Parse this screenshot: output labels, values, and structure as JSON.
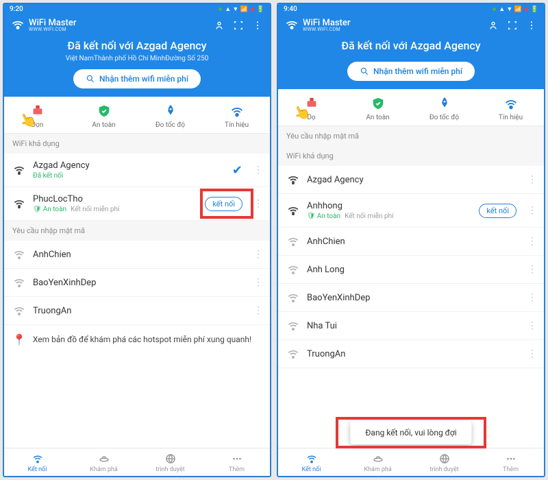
{
  "left": {
    "status": {
      "time": "9:20",
      "icons": [
        "📶",
        "🔋"
      ]
    },
    "brand": {
      "title": "WiFi Master",
      "sub": "WWW.WIFI.COM"
    },
    "header": {
      "conn_title": "Đã kết nối với Azgad Agency",
      "conn_sub": "Việt NamThành phố Hồ Chí MinhĐường Số 250",
      "free_btn": "Nhận thêm wifi miễn phí"
    },
    "features": {
      "clean": "Dọn",
      "safe": "An toàn",
      "speed": "Đo tốc độ",
      "signal": "Tín hiệu"
    },
    "sections": {
      "available": "WiFi khả dụng",
      "pwreq": "Yêu cầu nhập mật mã"
    },
    "networks_available": [
      {
        "name": "Azgad Agency",
        "sub_connected": "Đã kết nối",
        "connected": true
      },
      {
        "name": "PhucLocTho",
        "sub_safe": "An toàn",
        "sub_free": "Kết nối miễn phí",
        "connect_label": "kết nối",
        "highlight": true
      }
    ],
    "networks_pwreq": [
      {
        "name": "AnhChien"
      },
      {
        "name": "BaoYenXinhDep"
      },
      {
        "name": "TruongAn"
      }
    ],
    "map_hint": "Xem bản đồ để khám phá các hotspot miễn phí xung quanh!",
    "bottom": [
      {
        "label": "Kết nối",
        "active": true
      },
      {
        "label": "Khám phá"
      },
      {
        "label": "trình duyệt"
      },
      {
        "label": "Thêm"
      }
    ]
  },
  "right": {
    "status": {
      "time": "9:40",
      "icons": [
        "📶",
        "🔋"
      ]
    },
    "brand": {
      "title": "WiFi Master",
      "sub": "WWW.WIFI.COM"
    },
    "header": {
      "conn_title": "Đã kết nối với Azgad Agency",
      "conn_sub": "",
      "free_btn": "Nhận thêm wifi miễn phí"
    },
    "features": {
      "clean": "Dọ",
      "safe": "An toàn",
      "speed": "Đo tốc độ",
      "signal": "Tín hiệu"
    },
    "sections": {
      "pwreq": "Yêu cầu nhập mật mã",
      "available": "WiFi khả dụng"
    },
    "networks_available": [
      {
        "name": "Azgad Agency"
      },
      {
        "name": "Anhhong",
        "sub_safe": "An toàn",
        "sub_free": "Kết nối miễn phí",
        "connect_label": "kết nối"
      },
      {
        "name": "AnhChien"
      },
      {
        "name": "Anh Long"
      },
      {
        "name": "BaoYenXinhDep"
      },
      {
        "name": "Nha Tui"
      },
      {
        "name": "TruongAn"
      }
    ],
    "toast": "Đang kết nối, vui lòng đợi",
    "bottom": [
      {
        "label": "Kết nối",
        "active": true
      },
      {
        "label": "Khám phá"
      },
      {
        "label": "trình duyệt"
      },
      {
        "label": "Thêm"
      }
    ]
  }
}
